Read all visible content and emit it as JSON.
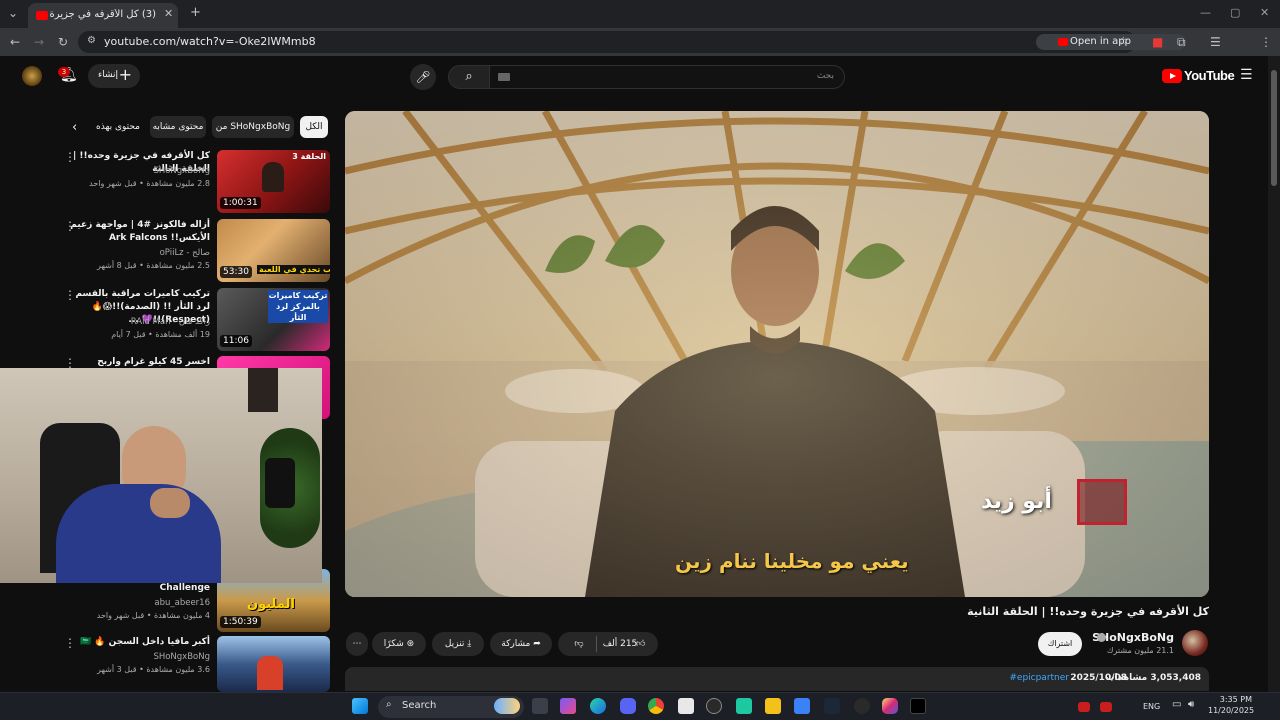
{
  "browser": {
    "tab_title": "(3) كل الأقرفه في جزيرة وحده",
    "url": "youtube.com/watch?v=-Oke2IWMmb8",
    "open_in_app": "Open in app"
  },
  "yt_header": {
    "logo": "YouTube",
    "search_placeholder": "بحث",
    "create_label": "إنشاء",
    "notifications_count": "3"
  },
  "chips": [
    "الكل",
    "من SHoNgxBoNg",
    "محتوى مشابه",
    "محتوى بهذه"
  ],
  "recommendations": [
    {
      "title": "كل الأقرفه في جزيرة وحده!! | الحلقة الثالثة",
      "channel": "SHoNgxBoNg",
      "meta": "2.8 مليون مشاهدة • قبل شهر واحد",
      "duration": "1:00:31",
      "thumb_text": "الحلقة 3"
    },
    {
      "title": "أزاله فالكونز #4 | مواجهة زعيم الأيكس!! Ark Falcons",
      "channel": "صالح - oPiiLz",
      "meta": "2.5 مليون مشاهدة • قبل 8 أشهر",
      "duration": "53:30",
      "thumb_text": "أصعب تحدي في اللعبة"
    },
    {
      "title": "تركيب كاميرات مراقبة بالقسم لرد الثأر !! (الصدمة)!!😱🔥 (Respect)!!💜 ...",
      "channel": "راكد مان - RAid Man",
      "meta": "19 ألف مشاهدة • قبل 7 أيام",
      "duration": "11:06",
      "thumb_text": "تركيب كاميرات بالمركز لرد الثأر"
    },
    {
      "title": "اخسر 45 كيلو غرام واربح 250,000",
      "channel": "",
      "meta": "",
      "duration": "",
      "thumb_text": ""
    },
    {
      "title": "Challenge",
      "channel": "abu_abeer16",
      "meta": "4 مليون مشاهدة • قبل شهر واحد",
      "duration": "1:50:39",
      "thumb_text": "المليون"
    },
    {
      "title": "أكبر مافيا داخل السجن 🔥 🇸🇦",
      "channel": "SHoNgxBoNg",
      "meta": "3.6 مليون مشاهدة • قبل 3 أشهر",
      "duration": "",
      "thumb_text": ""
    }
  ],
  "video": {
    "subtitle": "يعني مو مخلينا ننام زين",
    "nameplate": "أبو زيد",
    "title": "كل الأقرفه في جزيرة وحده!! | الحلقة الثانية",
    "channel": "SHoNgxBoNg",
    "subscribers": "21.1 مليون مشترك",
    "subscribe": "اشتراك",
    "likes": "215 ألف",
    "share": "مشاركة",
    "download": "تنزيل",
    "thanks": "شكرًا",
    "views": "3,053,408 مشاهدات",
    "date": "2025/10/08",
    "hashtag": "#epicpartner"
  },
  "taskbar": {
    "search": "Search",
    "lang": "ENG",
    "time": "3:35 PM",
    "date": "11/20/2025"
  },
  "colors": {
    "yt_red": "#ff0000",
    "bg": "#0f0f0f",
    "subtitle_yellow": "#f4c64a",
    "link_blue": "#3ea6ff"
  }
}
